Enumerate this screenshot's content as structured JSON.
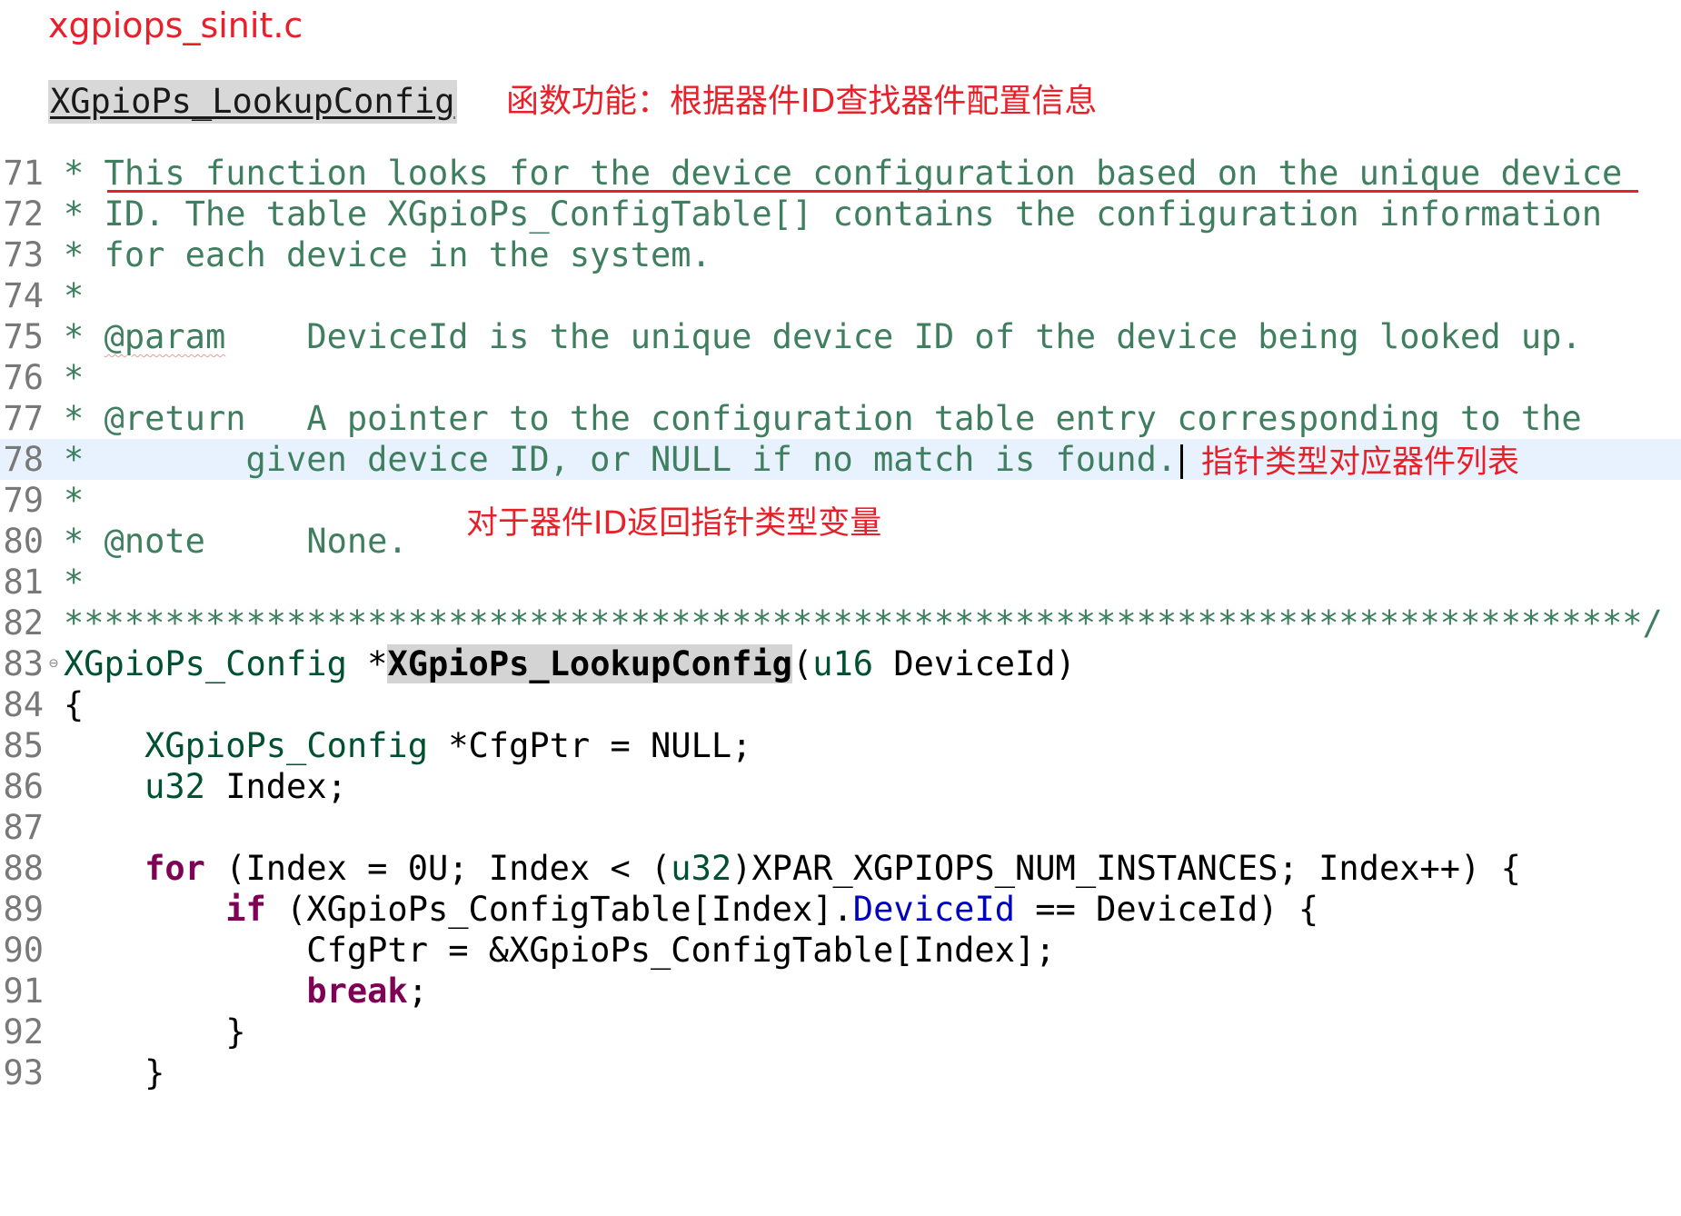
{
  "header": {
    "file_name": "xgpiops_sinit.c",
    "function_name": "XGpioPs_LookupConfig",
    "function_note": "函数功能：根据器件ID查找器件配置信息"
  },
  "annotations": {
    "return_note": "指针类型对应器件列表",
    "param_note": "对于器件ID返回指针类型变量"
  },
  "code": {
    "lines": [
      {
        "n": "71",
        "t": "* This function looks for the device configuration based on the unique device"
      },
      {
        "n": "72",
        "t": "* ID. The table XGpioPs_ConfigTable[] contains the configuration information"
      },
      {
        "n": "73",
        "t": "* for each device in the system."
      },
      {
        "n": "74",
        "t": "*"
      },
      {
        "n": "75",
        "a": "* ",
        "tag": "@param",
        "t": "    DeviceId is the unique device ID of the device being looked up."
      },
      {
        "n": "76",
        "t": "*"
      },
      {
        "n": "77",
        "a": "* ",
        "tag": "@return",
        "t": "   A pointer to the configuration table entry corresponding to the"
      },
      {
        "n": "78",
        "t": "*        given device ID, or NULL if no match is found."
      },
      {
        "n": "79",
        "t": "*"
      },
      {
        "n": "80",
        "a": "* ",
        "tag": "@note",
        "t": "     None."
      },
      {
        "n": "81",
        "t": "*"
      },
      {
        "n": "82",
        "t": "******************************************************************************/"
      },
      {
        "n": "83",
        "fold": "⊖",
        "type": "XGpioPs_Config",
        "sp": " *",
        "fn": "XGpioPs_LookupConfig",
        "rest": "(",
        "ptype": "u16",
        "rest2": " DeviceId)"
      },
      {
        "n": "84",
        "t": "{"
      },
      {
        "n": "85",
        "ind": "    ",
        "type": "XGpioPs_Config",
        "rest": " *CfgPtr = NULL;"
      },
      {
        "n": "86",
        "ind": "    ",
        "type": "u32",
        "rest": " Index;"
      },
      {
        "n": "87",
        "t": ""
      },
      {
        "n": "88",
        "ind": "    ",
        "kw": "for",
        "rest": " (Index = 0U; Index < (",
        "type": "u32",
        "rest2": ")XPAR_XGPIOPS_NUM_INSTANCES; Index++) {"
      },
      {
        "n": "89",
        "ind": "        ",
        "kw": "if",
        "rest": " (XGpioPs_ConfigTable[Index].",
        "fld": "DeviceId",
        "rest2": " == DeviceId) {"
      },
      {
        "n": "90",
        "t": "            CfgPtr = &XGpioPs_ConfigTable[Index];"
      },
      {
        "n": "91",
        "ind": "            ",
        "kw": "break",
        "rest": ";"
      },
      {
        "n": "92",
        "t": "        }"
      },
      {
        "n": "93",
        "t": "    }"
      }
    ]
  }
}
